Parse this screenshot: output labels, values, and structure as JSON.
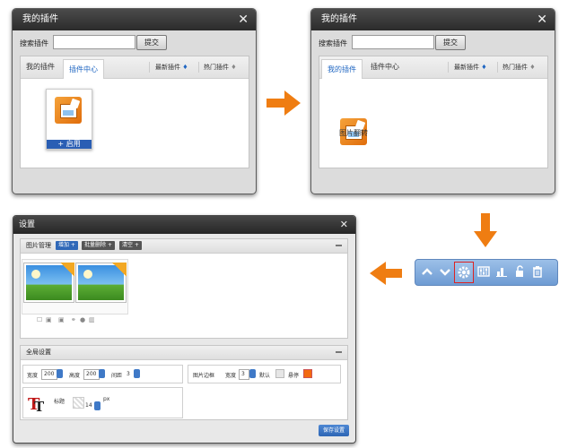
{
  "plugin_dialog": {
    "title": "我的插件",
    "close": "✕",
    "search_label": "搜索插件",
    "search_value": "",
    "submit_label": "提交",
    "tabs": [
      "我的插件",
      "插件中心"
    ],
    "sort_new": "最新插件",
    "sort_hot": "热门插件",
    "enable_label": "+ 启用",
    "plugin_name": "图片翻转"
  },
  "settings_dialog": {
    "title": "设置",
    "close": "✕",
    "image_section": {
      "title": "图片管理",
      "buttons": [
        {
          "label": "增加 +",
          "color": "#2f68b8"
        },
        {
          "label": "批量删除 +",
          "color": "#555555"
        },
        {
          "label": "清空 +",
          "color": "#555555"
        }
      ]
    },
    "global_section": {
      "title": "全局设置",
      "width_label": "宽度",
      "width_value": "200",
      "height_label": "高度",
      "height_value": "200",
      "spacing_label": "间距",
      "spacing_value": "3",
      "border_title": "图片边框",
      "border_width_label": "宽度",
      "border_width_value": "3",
      "default_label": "默认",
      "hover_label": "悬停",
      "hover_color": "#f26a10",
      "font_label": "标题",
      "font_size_value": "14",
      "font_unit": "px"
    },
    "save_label": "保存设置"
  },
  "accent_colors": {
    "arrow": "#ef7d12",
    "toolbar": "#7ea8dc",
    "link_blue": "#1f66c2"
  },
  "toolbar_icons": [
    "up-icon",
    "down-icon",
    "gear-icon",
    "sliders-icon",
    "chart-icon",
    "unlock-icon",
    "trash-icon"
  ]
}
